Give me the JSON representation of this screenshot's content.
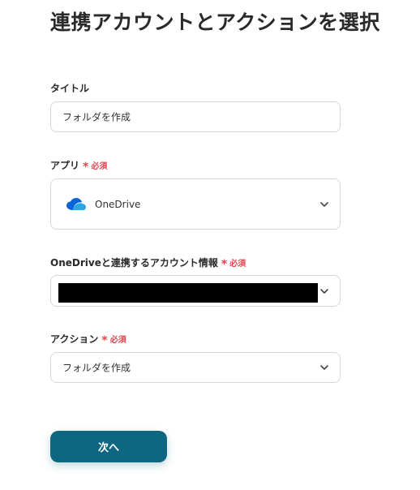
{
  "page": {
    "title": "連携アカウントとアクションを選択"
  },
  "fields": {
    "title_field": {
      "label": "タイトル",
      "value": "フォルダを作成"
    },
    "app_field": {
      "label": "アプリ",
      "required_mark": "*",
      "required_text": "必須",
      "app_name": "OneDrive",
      "app_icon": "onedrive-cloud-icon"
    },
    "account_field": {
      "label": "OneDriveと連携するアカウント情報",
      "required_mark": "*",
      "required_text": "必須"
    },
    "action_field": {
      "label": "アクション",
      "required_mark": "*",
      "required_text": "必須",
      "value": "フォルダを作成"
    }
  },
  "footer": {
    "next_label": "次へ"
  },
  "colors": {
    "accent": "#0f6680",
    "required": "#e0464f",
    "border": "#d4d7dc",
    "onedrive_dark": "#0a64d8",
    "onedrive_light": "#28a8ea"
  }
}
